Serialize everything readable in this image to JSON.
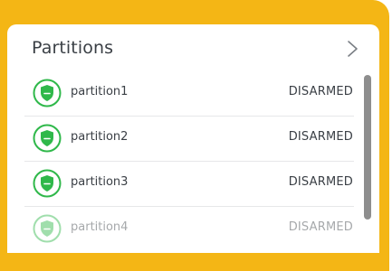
{
  "header": {
    "title": "Partitions",
    "chevron_icon": "chevron-right-icon"
  },
  "partitions": [
    {
      "name": "partition1",
      "status": "DISARMED",
      "icon": "shield-icon"
    },
    {
      "name": "partition2",
      "status": "DISARMED",
      "icon": "shield-icon"
    },
    {
      "name": "partition3",
      "status": "DISARMED",
      "icon": "shield-icon"
    },
    {
      "name": "partition4",
      "status": "DISARMED",
      "icon": "shield-icon"
    }
  ],
  "colors": {
    "frame": "#f4b615",
    "shield": "#2fb84a",
    "text": "#3a3f45",
    "scrollbar": "#8e8e8e"
  }
}
